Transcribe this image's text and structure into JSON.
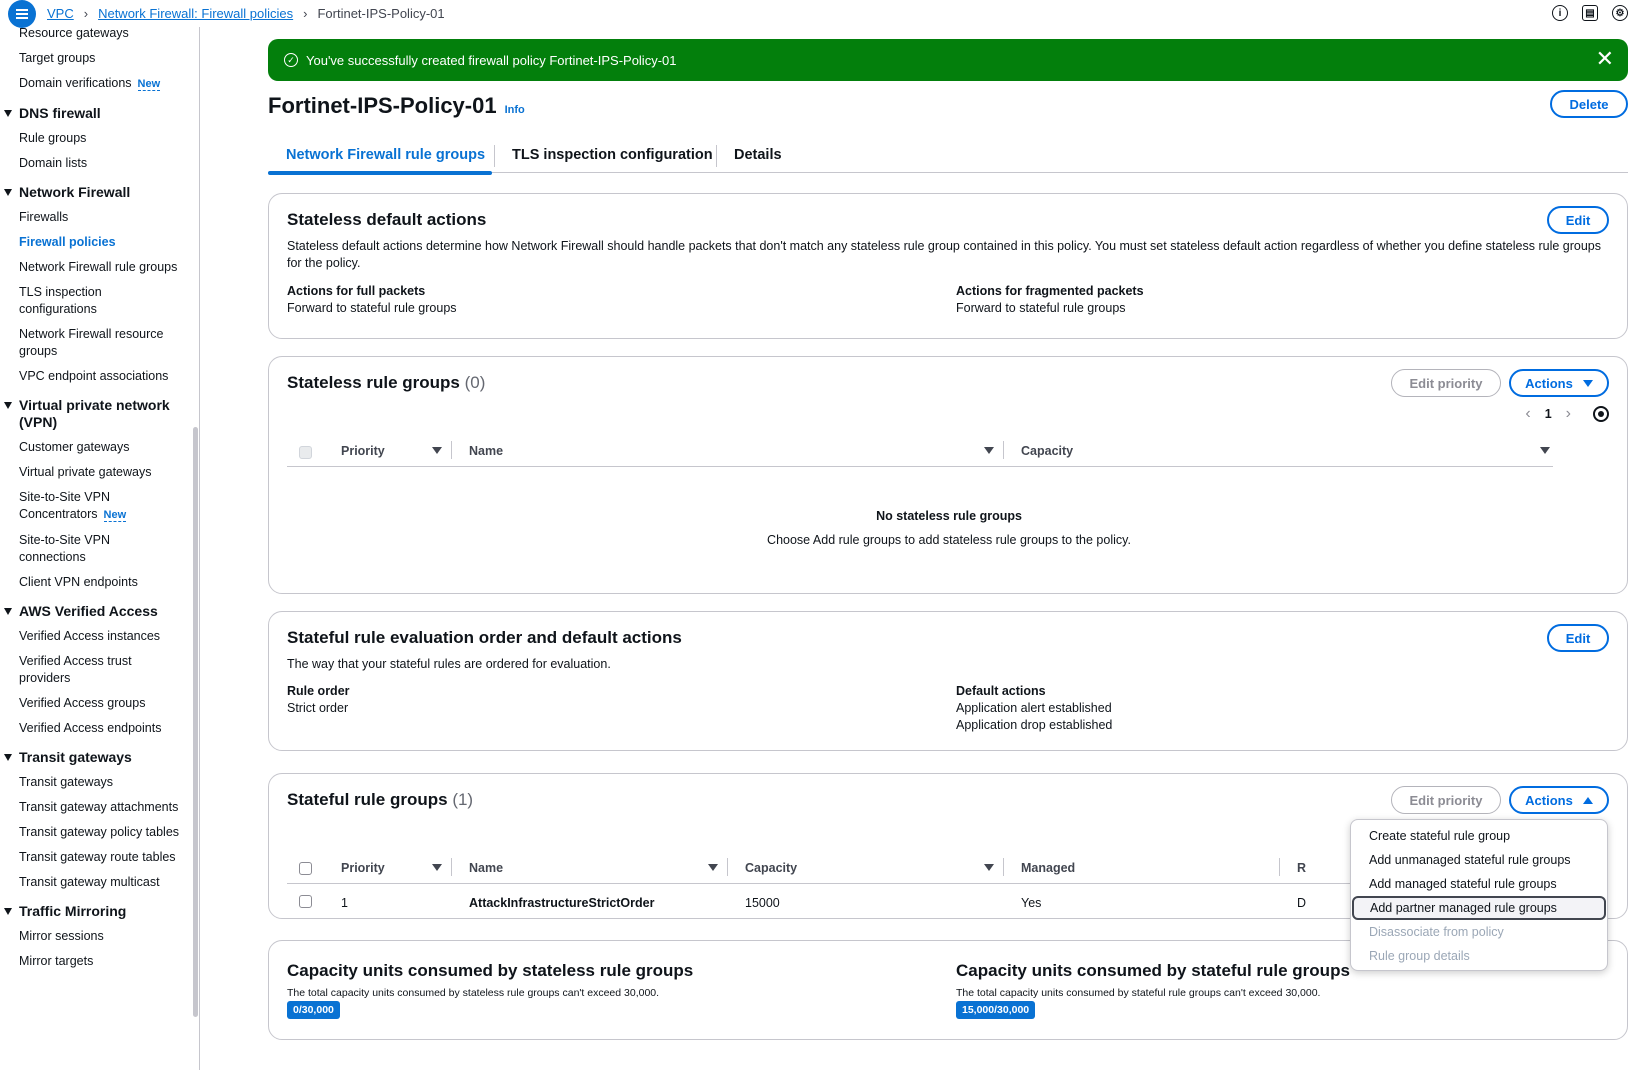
{
  "breadcrumb": {
    "items": [
      "VPC",
      "Network Firewall: Firewall policies"
    ],
    "current": "Fortinet-IPS-Policy-01"
  },
  "sidebar": {
    "top_items": [
      {
        "label": "Resource gateways"
      },
      {
        "label": "Target groups"
      },
      {
        "label": "Domain verifications",
        "badge": "New"
      }
    ],
    "groups": [
      {
        "title": "DNS firewall",
        "items": [
          {
            "label": "Rule groups"
          },
          {
            "label": "Domain lists"
          }
        ]
      },
      {
        "title": "Network Firewall",
        "items": [
          {
            "label": "Firewalls"
          },
          {
            "label": "Firewall policies",
            "active": true
          },
          {
            "label": "Network Firewall rule groups"
          },
          {
            "label": "TLS inspection configurations"
          },
          {
            "label": "Network Firewall resource groups"
          },
          {
            "label": "VPC endpoint associations"
          }
        ]
      },
      {
        "title": "Virtual private network (VPN)",
        "items": [
          {
            "label": "Customer gateways"
          },
          {
            "label": "Virtual private gateways"
          },
          {
            "label": "Site-to-Site VPN Concentrators",
            "badge": "New"
          },
          {
            "label": "Site-to-Site VPN connections"
          },
          {
            "label": "Client VPN endpoints"
          }
        ]
      },
      {
        "title": "AWS Verified Access",
        "items": [
          {
            "label": "Verified Access instances"
          },
          {
            "label": "Verified Access trust providers"
          },
          {
            "label": "Verified Access groups"
          },
          {
            "label": "Verified Access endpoints"
          }
        ]
      },
      {
        "title": "Transit gateways",
        "items": [
          {
            "label": "Transit gateways"
          },
          {
            "label": "Transit gateway attachments"
          },
          {
            "label": "Transit gateway policy tables"
          },
          {
            "label": "Transit gateway route tables"
          },
          {
            "label": "Transit gateway multicast"
          }
        ]
      },
      {
        "title": "Traffic Mirroring",
        "items": [
          {
            "label": "Mirror sessions"
          },
          {
            "label": "Mirror targets"
          }
        ]
      }
    ]
  },
  "flash": {
    "message": "You've successfully created firewall policy Fortinet-IPS-Policy-01",
    "color": "#037f0c"
  },
  "page": {
    "title": "Fortinet-IPS-Policy-01",
    "info": "Info",
    "delete_label": "Delete"
  },
  "tabs": [
    "Network Firewall rule groups",
    "TLS inspection configuration",
    "Details"
  ],
  "stateless_defaults": {
    "title": "Stateless default actions",
    "edit": "Edit",
    "description": "Stateless default actions determine how Network Firewall should handle packets that don't match any stateless rule group contained in this policy. You must set stateless default action regardless of whether you define stateless rule groups for the policy.",
    "full_label": "Actions for full packets",
    "full_value": "Forward to stateful rule groups",
    "frag_label": "Actions for fragmented packets",
    "frag_value": "Forward to stateful rule groups"
  },
  "stateless_groups": {
    "title": "Stateless rule groups",
    "count": "(0)",
    "edit_priority": "Edit priority",
    "actions": "Actions",
    "page": "1",
    "columns": [
      "Priority",
      "Name",
      "Capacity"
    ],
    "empty_title": "No stateless rule groups",
    "empty_sub": "Choose Add rule groups to add stateless rule groups to the policy."
  },
  "stateful_order": {
    "title": "Stateful rule evaluation order and default actions",
    "edit": "Edit",
    "description": "The way that your stateful rules are ordered for evaluation.",
    "order_label": "Rule order",
    "order_value": "Strict order",
    "defaults_label": "Default actions",
    "defaults_values": [
      "Application alert established",
      "Application drop established"
    ]
  },
  "stateful_groups": {
    "title": "Stateful rule groups",
    "count": "(1)",
    "edit_priority": "Edit priority",
    "actions": "Actions",
    "columns": [
      "Priority",
      "Name",
      "Capacity",
      "Managed",
      "R"
    ],
    "rows": [
      {
        "priority": "1",
        "name": "AttackInfrastructureStrictOrder",
        "capacity": "15000",
        "managed": "Yes",
        "r": "D"
      }
    ]
  },
  "actions_menu": [
    {
      "label": "Create stateful rule group"
    },
    {
      "label": "Add unmanaged stateful rule groups"
    },
    {
      "label": "Add managed stateful rule groups"
    },
    {
      "label": "Add partner managed rule groups",
      "hover": true
    },
    {
      "label": "Disassociate from policy",
      "disabled": true
    },
    {
      "label": "Rule group details",
      "disabled": true
    }
  ],
  "capacity": {
    "stateless_title": "Capacity units consumed by stateless rule groups",
    "stateless_desc": "The total capacity units consumed by stateless rule groups can't exceed 30,000.",
    "stateless_value": "0/30,000",
    "stateful_title": "Capacity units consumed by stateful rule groups",
    "stateful_desc": "The total capacity units consumed by stateful rule groups can't exceed 30,000.",
    "stateful_value": "15,000/30,000"
  }
}
